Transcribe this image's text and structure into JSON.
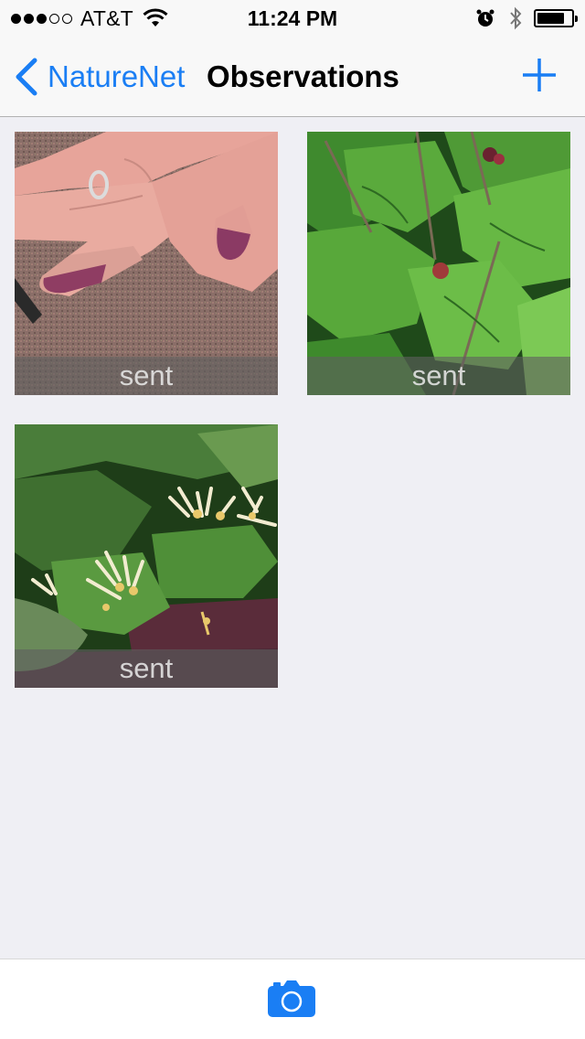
{
  "status_bar": {
    "carrier": "AT&T",
    "time": "11:24 PM",
    "signal_bars": 3,
    "signal_total": 5,
    "battery_level": 0.8,
    "icons": [
      "wifi-icon",
      "alarm-icon",
      "bluetooth-icon",
      "battery-icon"
    ]
  },
  "nav": {
    "back_label": "NatureNet",
    "title": "Observations",
    "add_icon": "plus-icon"
  },
  "observations": [
    {
      "caption": "sent",
      "image": "hand with purple-stained fingers"
    },
    {
      "caption": "sent",
      "image": "mulberry leaves and berries"
    },
    {
      "caption": "sent",
      "image": "honeysuckle flowers"
    }
  ],
  "toolbar": {
    "camera_icon": "camera-icon"
  },
  "colors": {
    "tint": "#1a7ef4",
    "background": "#efeff4",
    "bar": "#f8f8f8"
  }
}
